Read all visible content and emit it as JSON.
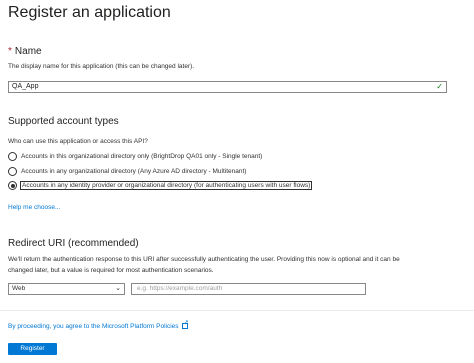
{
  "header": {
    "title": "Register an application",
    "more": "···"
  },
  "name_section": {
    "required_star": "*",
    "label": "Name",
    "hint": "The display name for this application (this can be changed later).",
    "value": "QA_App"
  },
  "account_types": {
    "heading": "Supported account types",
    "question": "Who can use this application or access this API?",
    "options": [
      {
        "label": "Accounts in this organizational directory only (BrightDrop QA01 only - Single tenant)",
        "selected": false
      },
      {
        "label": "Accounts in any organizational directory (Any Azure AD directory - Multitenant)",
        "selected": false
      },
      {
        "label": "Accounts in any identity provider or organizational directory (for authenticating users with user flows)",
        "selected": true
      }
    ],
    "help_link": "Help me choose..."
  },
  "redirect": {
    "heading": "Redirect URI (recommended)",
    "hint_line1": "We'll return the authentication response to this URI after successfully authenticating the user. Providing this now is optional and it can be",
    "hint_line2": "changed later, but a value is required for most authentication scenarios.",
    "platform_value": "Web",
    "uri_placeholder": "e.g. https://example.com/auth"
  },
  "footer": {
    "policy_text": "By proceeding, you agree to the Microsoft Platform Policies",
    "register_label": "Register"
  },
  "colors": {
    "accent": "#0078d4",
    "required": "#a4262c",
    "valid": "#107c10"
  }
}
